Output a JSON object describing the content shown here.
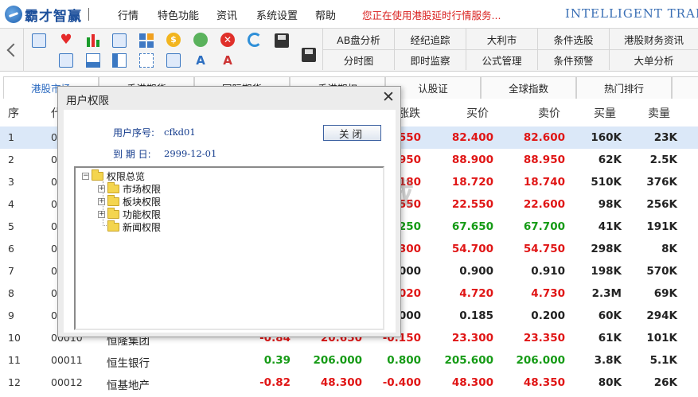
{
  "menubar": {
    "logo": "霸才智赢",
    "items": [
      "行情",
      "特色功能",
      "资讯",
      "系统设置",
      "帮助"
    ],
    "notice": "您正在使用港股延时行情服务...",
    "brand": "INTELLIGENT TRADE"
  },
  "toolbar": {
    "row1": [
      "AB盘分析",
      "经纪追踪",
      "大利市",
      "条件选股",
      "港股财务资讯"
    ],
    "row2": [
      "分时图",
      "即时监察",
      "公式管理",
      "条件预警",
      "大单分析"
    ]
  },
  "tabs": [
    "港股市场",
    "香港期货",
    "国际期货",
    "香港期权",
    "认股证",
    "全球指数",
    "热门排行"
  ],
  "table": {
    "headers": {
      "seq": "序",
      "code": "代",
      "change": "涨跌",
      "bid": "买价",
      "ask": "卖价",
      "bid_vol": "买量",
      "ask_vol": "卖量"
    },
    "rows": [
      {
        "seq": "1",
        "code": "00",
        "name": "",
        "pct": "",
        "last": "",
        "change": "0.550",
        "bid": "82.400",
        "ask": "82.600",
        "bid_vol": "160K",
        "ask_vol": "23K",
        "color": "red"
      },
      {
        "seq": "2",
        "code": "00",
        "name": "",
        "pct": "",
        "last": "",
        "change": "0.950",
        "bid": "88.900",
        "ask": "88.950",
        "bid_vol": "62K",
        "ask_vol": "2.5K",
        "color": "red"
      },
      {
        "seq": "3",
        "code": "00",
        "name": "",
        "pct": "",
        "last": "",
        "change": "0.180",
        "bid": "18.720",
        "ask": "18.740",
        "bid_vol": "510K",
        "ask_vol": "376K",
        "color": "red"
      },
      {
        "seq": "4",
        "code": "00",
        "name": "",
        "pct": "",
        "last": "",
        "change": "0.550",
        "bid": "22.550",
        "ask": "22.600",
        "bid_vol": "98K",
        "ask_vol": "256K",
        "color": "red"
      },
      {
        "seq": "5",
        "code": "00",
        "name": "",
        "pct": "",
        "last": "",
        "change": "0.250",
        "bid": "67.650",
        "ask": "67.700",
        "bid_vol": "41K",
        "ask_vol": "191K",
        "color": "green"
      },
      {
        "seq": "6",
        "code": "00",
        "name": "",
        "pct": "",
        "last": "",
        "change": "0.300",
        "bid": "54.700",
        "ask": "54.750",
        "bid_vol": "298K",
        "ask_vol": "8K",
        "color": "red"
      },
      {
        "seq": "7",
        "code": "00",
        "name": "",
        "pct": "",
        "last": "",
        "change": "0.000",
        "bid": "0.900",
        "ask": "0.910",
        "bid_vol": "198K",
        "ask_vol": "570K",
        "color": "dark"
      },
      {
        "seq": "8",
        "code": "00",
        "name": "",
        "pct": "",
        "last": "",
        "change": "0.020",
        "bid": "4.720",
        "ask": "4.730",
        "bid_vol": "2.3M",
        "ask_vol": "69K",
        "color": "red"
      },
      {
        "seq": "9",
        "code": "00",
        "name": "",
        "pct": "",
        "last": "",
        "change": "0.000",
        "bid": "0.185",
        "ask": "0.200",
        "bid_vol": "60K",
        "ask_vol": "294K",
        "color": "dark"
      },
      {
        "seq": "10",
        "code": "00010",
        "name": "恒隆集团",
        "pct": "-0.84",
        "last": "20.650",
        "change": "-0.150",
        "bid": "23.300",
        "ask": "23.350",
        "bid_vol": "61K",
        "ask_vol": "101K",
        "color": "red"
      },
      {
        "seq": "11",
        "code": "00011",
        "name": "恒生银行",
        "pct": "0.39",
        "last": "206.000",
        "change": "0.800",
        "bid": "205.600",
        "ask": "206.000",
        "bid_vol": "3.8K",
        "ask_vol": "5.1K",
        "color": "green"
      },
      {
        "seq": "12",
        "code": "00012",
        "name": "恒基地产",
        "pct": "-0.82",
        "last": "48.300",
        "change": "-0.400",
        "bid": "48.300",
        "ask": "48.350",
        "bid_vol": "80K",
        "ask_vol": "26K",
        "color": "red"
      }
    ]
  },
  "watermark": {
    "t1": "安下载",
    "t2": "anxz.com"
  },
  "dialog": {
    "title": "用户权限",
    "user_label": "用户序号:",
    "user_value": "cfkd01",
    "expire_label": "到 期 日:",
    "expire_value": "2999-12-01",
    "close_label": "关闭",
    "tree": {
      "root": "权限总览",
      "children": [
        "市场权限",
        "板块权限",
        "功能权限",
        "新闻权限"
      ]
    }
  }
}
